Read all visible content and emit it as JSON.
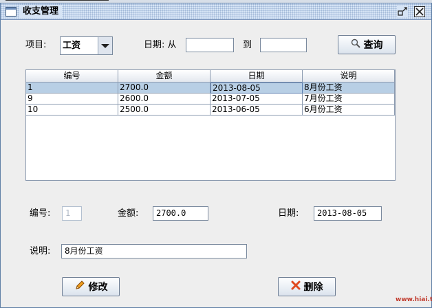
{
  "window": {
    "title": "收支管理"
  },
  "filter": {
    "item_label": "项目:",
    "item_selected": "工资",
    "date_from_label": "日期: 从",
    "date_from_value": "",
    "date_to_label": "到",
    "date_to_value": "",
    "search_label": "查询"
  },
  "table": {
    "columns": [
      "编号",
      "金额",
      "日期",
      "说明"
    ],
    "rows": [
      [
        "1",
        "2700.0",
        "2013-08-05",
        "8月份工资"
      ],
      [
        "9",
        "2600.0",
        "2013-07-05",
        "7月份工资"
      ],
      [
        "10",
        "2500.0",
        "2013-06-05",
        "6月份工资"
      ]
    ],
    "selected_row": 0
  },
  "form": {
    "id_label": "编号:",
    "id_value": "1",
    "amount_label": "金额:",
    "amount_value": "2700.0",
    "date_label": "日期:",
    "date_value": "2013-08-05",
    "desc_label": "说明:",
    "desc_value": "8月份工资"
  },
  "actions": {
    "edit_label": "修改",
    "delete_label": "删除"
  },
  "watermark": "www.hiai.top",
  "icons": {
    "search": "magnifier-icon",
    "edit": "pencil-icon",
    "delete": "red-x-icon"
  },
  "colors": {
    "selection": "#b8cfe5",
    "delete_icon": "#e04a1f",
    "edit_icon": "#e0901a"
  }
}
